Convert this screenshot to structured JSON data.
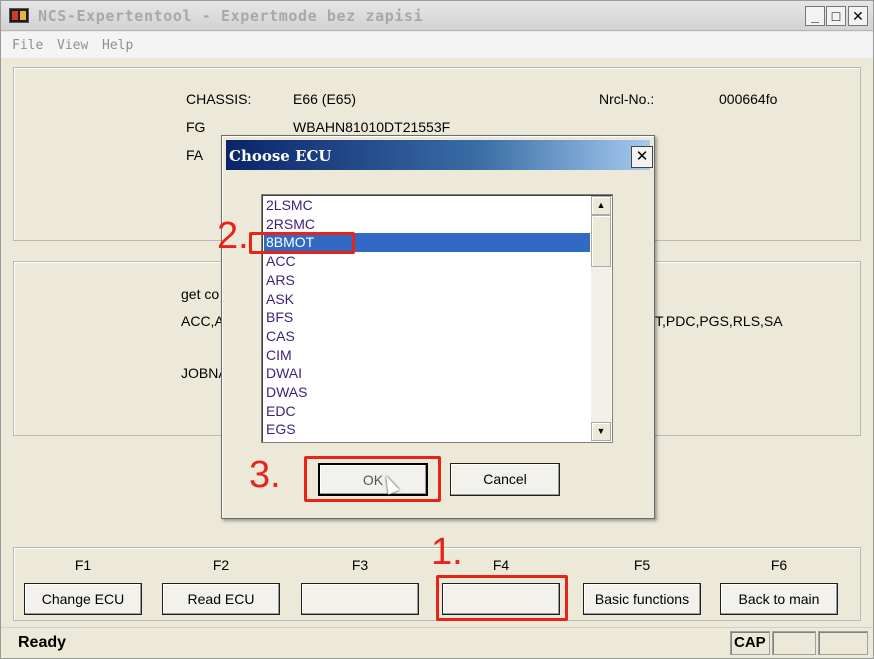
{
  "window": {
    "title": "NCS-Expertentool - Expertmode bez zapisi",
    "controls": [
      "_",
      "□",
      "✕"
    ]
  },
  "menu": [
    "File",
    "View",
    "Help"
  ],
  "info_panel": {
    "chassis_label": "CHASSIS:",
    "chassis_value": "E66 (E65)",
    "fg_label": "FG",
    "fg_value": "WBAHN81010DT21553F",
    "fa_label": "FA",
    "nrcl_label": "Nrcl-No.:",
    "nrcl_value": "000664fo"
  },
  "job_panel": {
    "line1": "get co",
    "line2": "ACC,A",
    "line2_right": "T,PDC,PGS,RLS,SA",
    "line3": "JOBNA"
  },
  "fkeys": [
    {
      "key": "F1",
      "label": "Change ECU"
    },
    {
      "key": "F2",
      "label": "Read ECU"
    },
    {
      "key": "F3",
      "label": ""
    },
    {
      "key": "F4",
      "label": ""
    },
    {
      "key": "F5",
      "label": "Basic functions"
    },
    {
      "key": "F6",
      "label": "Back to main"
    }
  ],
  "status": {
    "text": "Ready",
    "cap": "CAP"
  },
  "dialog": {
    "title": "Choose ECU",
    "close": "✕",
    "items": [
      "2LSMC",
      "2RSMC",
      "8BMOT",
      "ACC",
      "ARS",
      "ASK",
      "BFS",
      "CAS",
      "CIM",
      "DWAI",
      "DWAS",
      "EDC",
      "EGS"
    ],
    "selected": "8BMOT",
    "ok_label": "OK",
    "cancel_label": "Cancel"
  },
  "annotations": {
    "step1": "1.",
    "step2": "2.",
    "step3": "3.",
    "color": "#e8231a"
  },
  "colors": {
    "selection": "#316ac5",
    "dialog_title": "#0a246a"
  }
}
